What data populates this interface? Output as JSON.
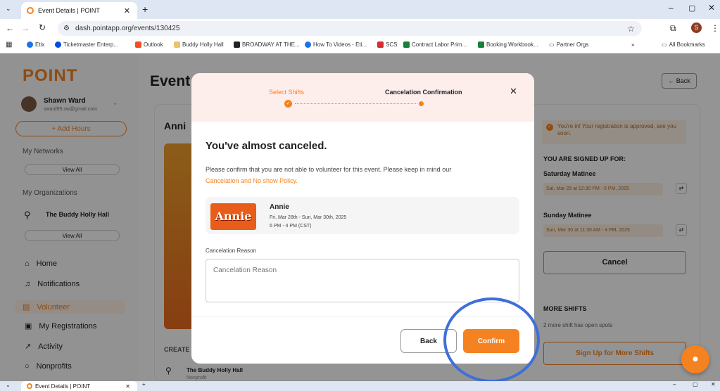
{
  "browser": {
    "tab_title": "Event Details | POINT",
    "url": "dash.pointapp.org/events/130425",
    "bookmarks": [
      "Etix",
      "Ticketmaster Enterp...",
      "Outlook",
      "Buddy Holly Hall",
      "BROADWAY AT THE...",
      "How To Videos - Eti...",
      "SCS",
      "Contract Labor Prim...",
      "Booking Workbook...",
      "Partner Orgs"
    ],
    "all_bookmarks": "All Bookmarks",
    "overflow": "»",
    "avatar_letter": "S"
  },
  "sidebar": {
    "logo": "POINT",
    "user_name": "Shawn Ward",
    "user_email": "sward95.sw@gmail.com",
    "add_hours": "+ Add Hours",
    "my_networks": "My Networks",
    "view_all": "View All",
    "my_organizations": "My Organizations",
    "org_name": "The Buddy Holly Hall",
    "nav": [
      "Home",
      "Notifications",
      "Volunteer",
      "My Registrations",
      "Activity",
      "Nonprofits"
    ]
  },
  "main": {
    "page_title": "Event",
    "back": "← Back",
    "event_short": "Anni",
    "created_by": "CREATE",
    "org": "The Buddy Holly Hall",
    "org_type": "Nonprofit"
  },
  "right_panel": {
    "notice": "You're in! Your registration is approved, see you soon.",
    "signed_up_title": "YOU ARE SIGNED UP FOR:",
    "shift1_name": "Saturday Matinee",
    "shift1_time": "Sat, Mar 29 at 12:30 PM - 5 PM, 2025",
    "shift2_name": "Sunday Matinee",
    "shift2_time": "Sun, Mar 30 at 11:30 AM - 4 PM, 2025",
    "cancel": "Cancel",
    "more_shifts_title": "MORE SHIFTS",
    "more_shifts_text": "2 more shift has open spots",
    "sign_up_more": "Sign Up for More Shifts"
  },
  "modal": {
    "step1": "Select Shifts",
    "step2": "Cancelation Confirmation",
    "heading": "You've almost canceled.",
    "body": "Please confirm that you are not able to volunteer for this event. Please keep in mind our",
    "policy_link": "Cancelation and No show Policy.",
    "event_logo_text": "Annie",
    "event_name": "Annie",
    "event_dates": "Fri, Mar 28th - Sun, Mar 30th, 2025",
    "event_time": "6 PM - 4 PM (CST)",
    "reason_label": "Cancelation Reason",
    "reason_placeholder": "Cancelation Reason",
    "back_button": "Back",
    "confirm_button": "Confirm"
  },
  "colors": {
    "brand": "#f58220",
    "highlight_circle": "#3f6fd8"
  }
}
